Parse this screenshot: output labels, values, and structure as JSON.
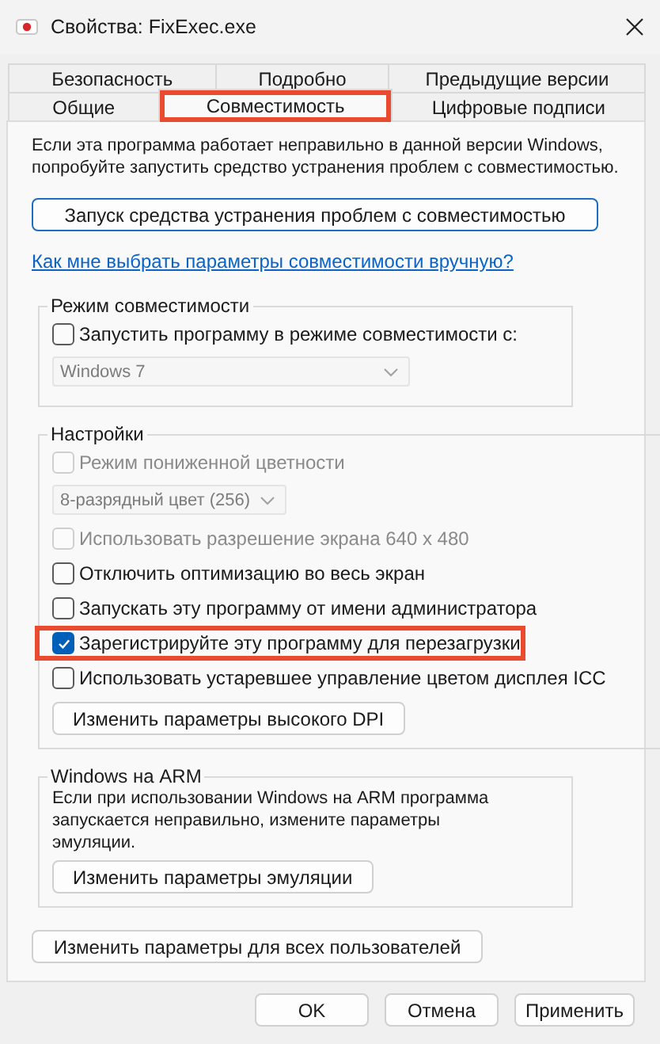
{
  "window": {
    "title": "Свойства: FixExec.exe"
  },
  "tab_rows": [
    {
      "tabs": [
        {
          "label": "Безопасность",
          "selected": false,
          "highlighted": false
        },
        {
          "label": "Подробно",
          "selected": false,
          "highlighted": false
        },
        {
          "label": "Предыдущие версии",
          "selected": false,
          "highlighted": false
        }
      ]
    },
    {
      "tabs": [
        {
          "label": "Общие",
          "selected": false,
          "highlighted": false
        },
        {
          "label": "Совместимость",
          "selected": true,
          "highlighted": true
        },
        {
          "label": "Цифровые подписи",
          "selected": false,
          "highlighted": false
        }
      ]
    }
  ],
  "intro": "Если эта программа работает неправильно в данной версии Windows,\nпопробуйте запустить средство устранения проблем с совместимостью.",
  "troubleshoot_button": "Запуск средства устранения проблем с совместимостью",
  "help_link": "Как мне выбрать параметры совместимости вручную?",
  "groups": [
    {
      "title": "Режим совместимости",
      "items": [
        {
          "kind": "checkbox",
          "label": "Запустить программу в режиме совместимости с:",
          "checked": false,
          "disabled": false,
          "highlighted": false
        },
        {
          "kind": "dropdown",
          "value": "Windows 7",
          "disabled": true
        }
      ]
    },
    {
      "title": "Настройки",
      "items": [
        {
          "kind": "checkbox",
          "label": "Режим пониженной цветности",
          "checked": false,
          "disabled": true,
          "highlighted": false
        },
        {
          "kind": "dropdown",
          "value": "8-разрядный цвет (256)",
          "disabled": true
        },
        {
          "kind": "checkbox",
          "label": "Использовать разрешение экрана 640 x 480",
          "checked": false,
          "disabled": true,
          "highlighted": false
        },
        {
          "kind": "checkbox",
          "label": "Отключить оптимизацию во весь экран",
          "checked": false,
          "disabled": false,
          "highlighted": false
        },
        {
          "kind": "checkbox",
          "label": "Запускать эту программу от имени администратора",
          "checked": false,
          "disabled": false,
          "highlighted": false
        },
        {
          "kind": "checkbox",
          "label": "Зарегистрируйте эту программу для перезагрузки",
          "checked": true,
          "disabled": false,
          "highlighted": true
        },
        {
          "kind": "checkbox",
          "label": "Использовать устаревшее управление цветом дисплея ICC",
          "checked": false,
          "disabled": false,
          "highlighted": false
        },
        {
          "kind": "button",
          "label": "Изменить параметры высокого DPI"
        }
      ]
    },
    {
      "title": "Windows на ARM",
      "items": [
        {
          "kind": "text",
          "text": "Если при использовании Windows на ARM программа\nзапускается неправильно, измените параметры\nэмуляции."
        },
        {
          "kind": "button",
          "label": "Изменить параметры эмуляции"
        }
      ]
    }
  ],
  "all_users_button": "Изменить параметры для всех пользователей",
  "dialog_buttons": [
    "OK",
    "Отмена",
    "Применить"
  ]
}
